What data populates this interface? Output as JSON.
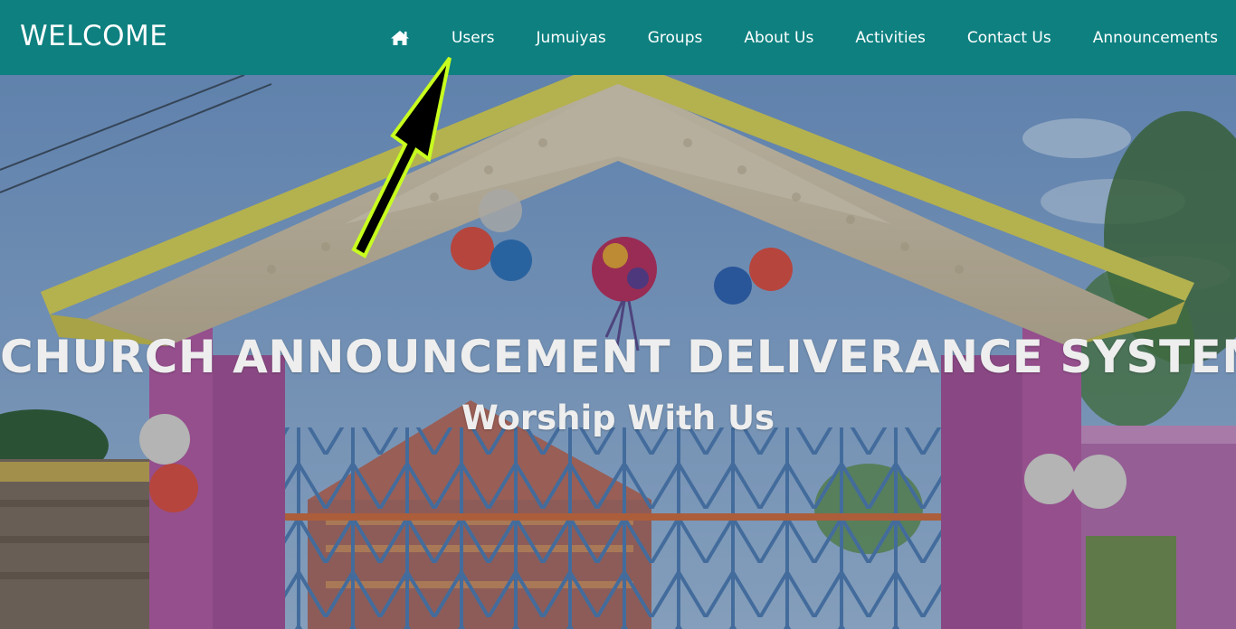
{
  "navbar": {
    "brand": "WELCOME",
    "home_icon": "home-icon",
    "links": [
      {
        "label": "Users"
      },
      {
        "label": "Jumuiyas"
      },
      {
        "label": "Groups"
      },
      {
        "label": "About Us"
      },
      {
        "label": "Activities"
      },
      {
        "label": "Contact Us"
      },
      {
        "label": "Announcements"
      }
    ],
    "background_color": "#0e8080"
  },
  "hero": {
    "title": "CHURCH ANNOUNCEMENT DELIVERANCE SYSTEM",
    "subtitle": "Worship With Us",
    "image_description_icon": "church-gate-photo"
  },
  "annotation": {
    "arrow_icon": "pointer-arrow-icon",
    "arrow_color": "#c8ff1e"
  }
}
